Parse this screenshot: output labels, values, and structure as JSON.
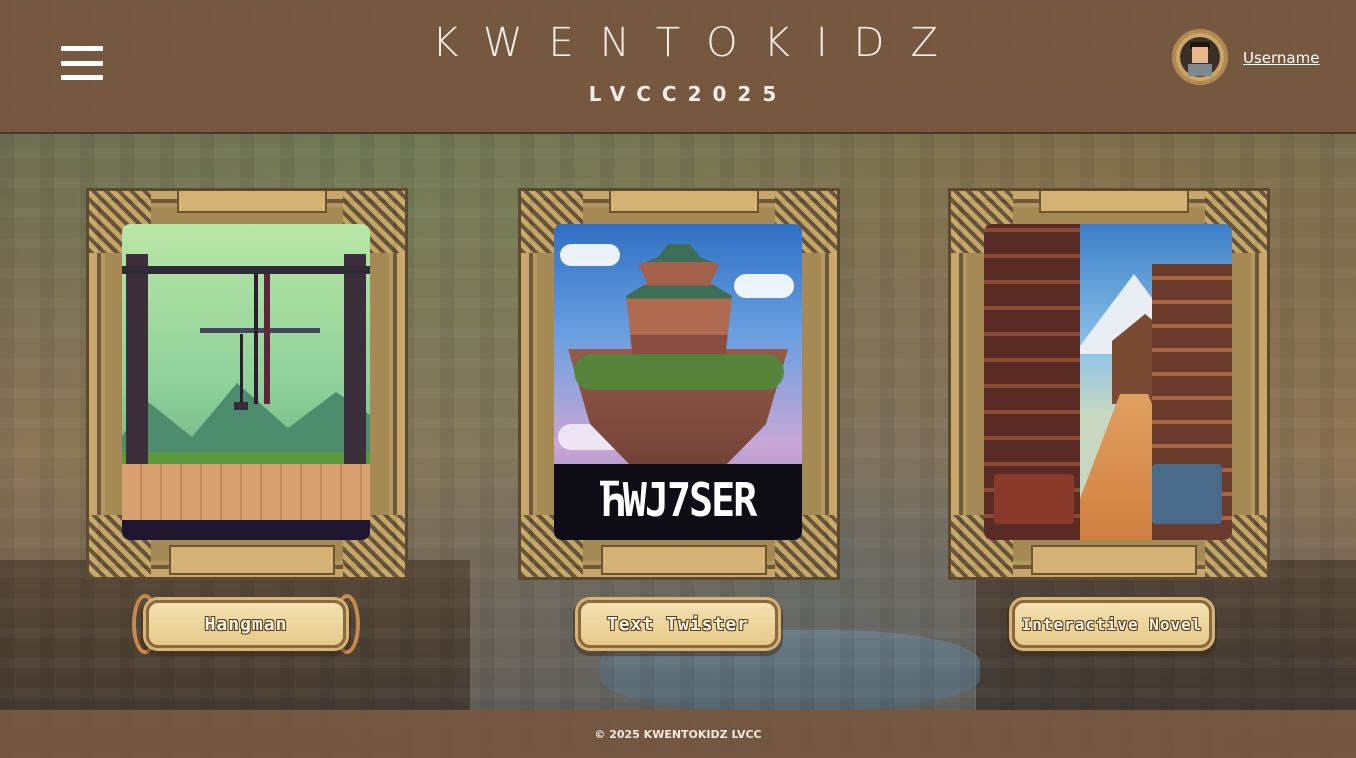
{
  "header": {
    "title": "KWENTOKIDZ",
    "subtitle": "LVCC2025",
    "username": "Username"
  },
  "games": [
    {
      "label": "Hangman",
      "art_logo": ""
    },
    {
      "label": "Text Twister",
      "art_logo": "ЋWJ7SER"
    },
    {
      "label": "Interactive Novel",
      "art_logo": ""
    }
  ],
  "footer": {
    "copyright": "© 2025 KWENTOKIDZ LVCC"
  },
  "colors": {
    "header_bg": "#76563e",
    "frame_gold": "#c7a76a",
    "button_face": "#e6c98a",
    "text_light": "#f2ede6"
  },
  "icons": {
    "menu": "hamburger-menu-icon",
    "user": "avatar-icon"
  }
}
